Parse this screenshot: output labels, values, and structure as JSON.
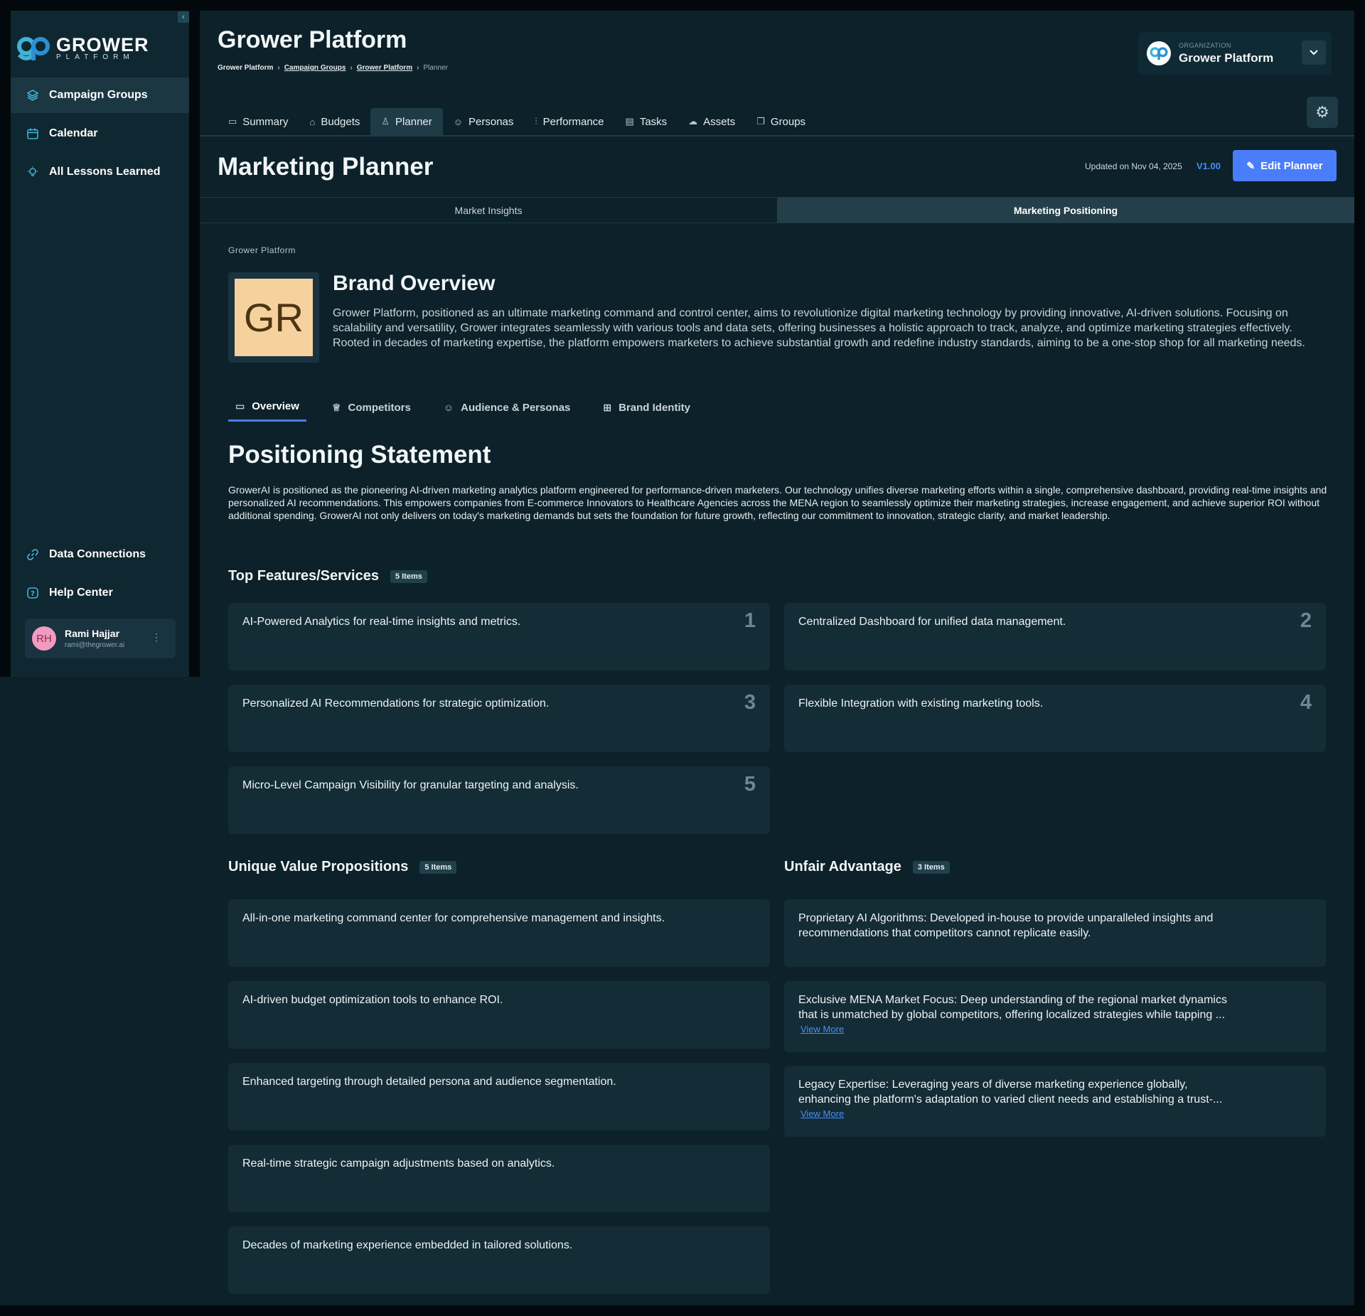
{
  "sidebar": {
    "logo": {
      "big": "GROWER",
      "small": "PLATFORM"
    },
    "items": [
      {
        "label": "Campaign Groups",
        "icon": "layers-icon",
        "active": true
      },
      {
        "label": "Calendar",
        "icon": "calendar-icon"
      },
      {
        "label": "All Lessons Learned",
        "icon": "lightbulb-icon"
      }
    ],
    "bottom_items": [
      {
        "label": "Data Connections",
        "icon": "link-icon"
      },
      {
        "label": "Help Center",
        "icon": "help-icon"
      }
    ],
    "user": {
      "initials": "RH",
      "name": "Rami Hajjar",
      "email": "rami@thegrower.ai"
    }
  },
  "header": {
    "title": "Grower Platform",
    "breadcrumb": [
      "Grower Platform",
      "Campaign Groups",
      "Grower Platform",
      "Planner"
    ],
    "org_label": "ORGANIZATION",
    "org_name": "Grower Platform"
  },
  "tabs": [
    "Summary",
    "Budgets",
    "Planner",
    "Personas",
    "Performance",
    "Tasks",
    "Assets",
    "Groups"
  ],
  "active_tab": "Planner",
  "page": {
    "title": "Marketing Planner",
    "updated": "Updated on Nov 04, 2025",
    "version": "V1.00",
    "edit_label": "Edit Planner"
  },
  "segments": [
    "Market Insights",
    "Marketing Positioning"
  ],
  "brand": {
    "label": "Grower Platform",
    "initials": "GR",
    "title": "Brand Overview",
    "description": "Grower Platform, positioned as an ultimate marketing command and control center, aims to revolutionize digital marketing technology by providing innovative, AI-driven solutions. Focusing on scalability and versatility, Grower integrates seamlessly with various tools and data sets, offering businesses a holistic approach to track, analyze, and optimize marketing strategies effectively. Rooted in decades of marketing expertise, the platform empowers marketers to achieve substantial growth and redefine industry standards, aiming to be a one-stop shop for all marketing needs."
  },
  "subtabs": [
    "Overview",
    "Competitors",
    "Audience & Personas",
    "Brand Identity"
  ],
  "positioning": {
    "title": "Positioning Statement",
    "text": "GrowerAI is positioned as the pioneering AI-driven marketing analytics platform engineered for performance-driven marketers. Our technology unifies diverse marketing efforts within a single, comprehensive dashboard, providing real-time insights and personalized AI recommendations. This empowers companies from E-commerce Innovators to Healthcare Agencies across the MENA region to seamlessly optimize their marketing strategies, increase engagement, and achieve superior ROI without additional spending. GrowerAI not only delivers on today's marketing demands but sets the foundation for future growth, reflecting our commitment to innovation, strategic clarity, and market leadership."
  },
  "features": {
    "title": "Top Features/Services",
    "badge": "5 Items",
    "items": [
      {
        "text": "AI-Powered Analytics for real-time insights and metrics.",
        "num": "1"
      },
      {
        "text": "Centralized Dashboard for unified data management.",
        "num": "2"
      },
      {
        "text": "Personalized AI Recommendations for strategic optimization.",
        "num": "3"
      },
      {
        "text": "Flexible Integration with existing marketing tools.",
        "num": "4"
      },
      {
        "text": "Micro-Level Campaign Visibility for granular targeting and analysis.",
        "num": "5"
      }
    ]
  },
  "uvp": {
    "title": "Unique Value Propositions",
    "badge": "5 Items",
    "items": [
      "All-in-one marketing command center for comprehensive management and insights.",
      "AI-driven budget optimization tools to enhance ROI.",
      "Enhanced targeting through detailed persona and audience segmentation.",
      "Real-time strategic campaign adjustments based on analytics.",
      "Decades of marketing experience embedded in tailored solutions."
    ]
  },
  "advantage": {
    "title": "Unfair Advantage",
    "badge": "3 Items",
    "view_more": "View More",
    "items": [
      {
        "line1": "Proprietary AI Algorithms: Developed in-house to provide unparalleled insights and",
        "line2": "recommendations that competitors cannot replicate easily."
      },
      {
        "line1": "Exclusive MENA Market Focus: Deep understanding of the regional market dynamics",
        "line2": "that is unmatched by global competitors, offering localized strategies while tapping ..."
      },
      {
        "line1": "Legacy Expertise: Leveraging years of diverse marketing experience globally,",
        "line2": "enhancing the platform's adaptation to varied client needs and establishing a trust-..."
      }
    ]
  },
  "colors": {
    "accent": "#4a7dfa",
    "link": "#4a8dff",
    "background": "#0c2129",
    "brand_tile": "#f5d19e"
  }
}
